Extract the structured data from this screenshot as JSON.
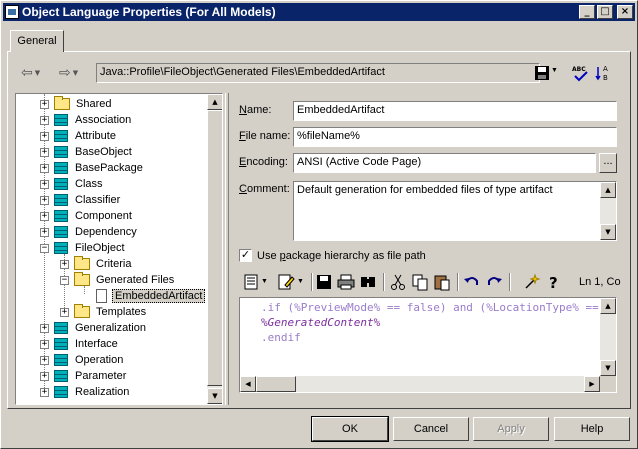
{
  "window": {
    "title": "Object Language Properties (For All Models)",
    "minimize_glyph": "_",
    "maximize_glyph": "□",
    "close_glyph": "×"
  },
  "tabs": [
    {
      "label": "General",
      "active": true
    }
  ],
  "path_toolbar": {
    "back_glyph": "⇦",
    "forward_glyph": "⇨",
    "dropdown_glyph": "▼",
    "path": "Java::Profile\\FileObject\\Generated Files\\EmbeddedArtifact",
    "icons": [
      "save-icon",
      "spell-check-icon",
      "sort-icon"
    ]
  },
  "tree": {
    "items": [
      {
        "label": "Shared",
        "icon": "folder-icon",
        "level": 0,
        "expander": "+"
      },
      {
        "label": "Association",
        "icon": "class-icon",
        "level": 0,
        "expander": "+"
      },
      {
        "label": "Attribute",
        "icon": "class-icon",
        "level": 0,
        "expander": "+"
      },
      {
        "label": "BaseObject",
        "icon": "class-icon",
        "level": 0,
        "expander": "+"
      },
      {
        "label": "BasePackage",
        "icon": "class-icon",
        "level": 0,
        "expander": "+"
      },
      {
        "label": "Class",
        "icon": "class-icon",
        "level": 0,
        "expander": "+"
      },
      {
        "label": "Classifier",
        "icon": "class-icon",
        "level": 0,
        "expander": "+"
      },
      {
        "label": "Component",
        "icon": "class-icon",
        "level": 0,
        "expander": "+"
      },
      {
        "label": "Dependency",
        "icon": "class-icon",
        "level": 0,
        "expander": "+"
      },
      {
        "label": "FileObject",
        "icon": "class-icon",
        "level": 0,
        "expander": "−"
      },
      {
        "label": "Criteria",
        "icon": "folder-icon",
        "level": 1,
        "expander": "+"
      },
      {
        "label": "Generated Files",
        "icon": "folder-icon",
        "level": 1,
        "expander": "−"
      },
      {
        "label": "EmbeddedArtifact",
        "icon": "file-icon",
        "level": 2,
        "expander": "",
        "selected": true
      },
      {
        "label": "Templates",
        "icon": "folder-icon",
        "level": 1,
        "expander": "+"
      },
      {
        "label": "Generalization",
        "icon": "class-icon",
        "level": 0,
        "expander": "+"
      },
      {
        "label": "Interface",
        "icon": "class-icon",
        "level": 0,
        "expander": "+"
      },
      {
        "label": "Operation",
        "icon": "class-icon",
        "level": 0,
        "expander": "+"
      },
      {
        "label": "Parameter",
        "icon": "class-icon",
        "level": 0,
        "expander": "+"
      },
      {
        "label": "Realization",
        "icon": "class-icon",
        "level": 0,
        "expander": "+"
      }
    ]
  },
  "scroll_glyphs": {
    "up": "▲",
    "down": "▼",
    "left": "◀",
    "right": "▶"
  },
  "properties": {
    "name_label_key": "N",
    "name_label_rest": "ame:",
    "name_value": "EmbeddedArtifact",
    "filename_label_key": "F",
    "filename_label_rest": "ile name:",
    "filename_value": "%fileName%",
    "encoding_label_key": "E",
    "encoding_label_rest": "ncoding:",
    "encoding_value": "ANSI (Active Code Page)",
    "encoding_browse": "...",
    "comment_label_key": "C",
    "comment_label_rest": "omment:",
    "comment_value": "Default generation for embedded files of type artifact",
    "use_package_checked": true,
    "use_package_check_glyph": "✓",
    "use_package_label_pre": "Use ",
    "use_package_label_key": "p",
    "use_package_label_post": "ackage hierarchy as file path"
  },
  "editor": {
    "toolbar_icons": [
      "properties-menu-icon",
      "edit-menu-icon",
      "save-icon",
      "print-icon",
      "find-icon",
      "cut-icon",
      "copy-icon",
      "paste-icon",
      "undo-icon",
      "redo-icon",
      "insert-variable-icon",
      "help-icon"
    ],
    "cursor_position": "Ln 1, Co",
    "lines": [
      [
        {
          "text": ".if (",
          "cls": "c-purple"
        },
        {
          "text": "%PreviewMode%",
          "cls": "c-purple"
        },
        {
          "text": " == false) and (",
          "cls": "c-purple"
        },
        {
          "text": "%LocationType%",
          "cls": "c-purple"
        },
        {
          "text": " ==",
          "cls": "c-purple"
        }
      ],
      [
        {
          "text": "%GeneratedContent%",
          "cls": "c-var"
        }
      ],
      [
        {
          "text": ".endif",
          "cls": "c-purple"
        }
      ]
    ]
  },
  "footer": {
    "ok": "OK",
    "cancel": "Cancel",
    "apply": "Apply",
    "help": "Help"
  }
}
